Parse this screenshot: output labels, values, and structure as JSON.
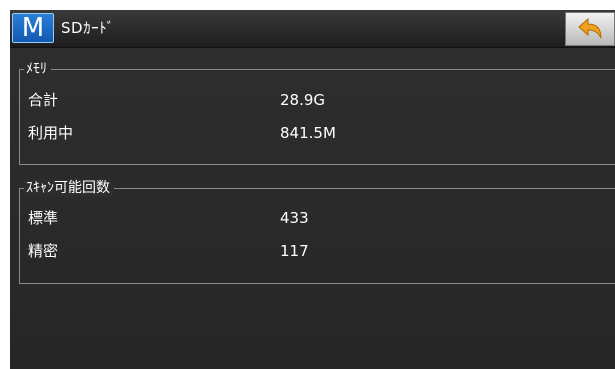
{
  "header": {
    "menu_letter": "M",
    "title": "SDｶｰﾄﾞ",
    "back_icon": "back-arrow-icon"
  },
  "memory": {
    "legend": "ﾒﾓﾘ",
    "rows": [
      {
        "label": "合計",
        "value": "28.9G"
      },
      {
        "label": "利用中",
        "value": "841.5M"
      }
    ]
  },
  "scan": {
    "legend": "ｽｷｬﾝ可能回数",
    "rows": [
      {
        "label": "標準",
        "value": "433"
      },
      {
        "label": "精密",
        "value": "117"
      }
    ]
  },
  "colors": {
    "menu_blue": "#1c6fd0",
    "back_arrow": "#f0a020",
    "background": "#2b2b2b",
    "text": "#ffffff"
  }
}
